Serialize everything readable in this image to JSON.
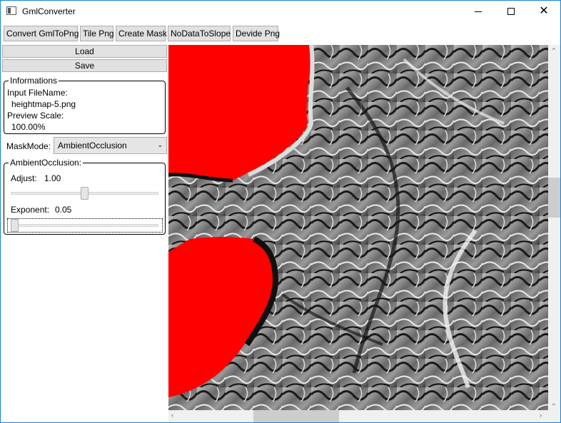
{
  "window": {
    "title": "GmlConverter",
    "controls": {
      "minimize": "minimize-icon",
      "maximize": "maximize-icon",
      "close": "close-icon"
    }
  },
  "toolbar": {
    "buttons": [
      "Convert GmlToPng",
      "Tile Png",
      "Create Mask",
      "NoDataToSlope",
      "Devide Png"
    ]
  },
  "panel": {
    "load_label": "Load",
    "save_label": "Save",
    "informations": {
      "title": "Informations",
      "input_filename_label": "Input FileName:",
      "input_filename_value": "heightmap-5.png",
      "preview_scale_label": "Preview Scale:",
      "preview_scale_value": "100.00%"
    },
    "mask_mode": {
      "label": "MaskMode:",
      "selected": "AmbientOcclusion"
    },
    "ambient_occlusion": {
      "title": "AmbientOcclusion:",
      "adjust_label": "Adjust:",
      "adjust_value": "1.00",
      "adjust_level": 0.5,
      "exponent_label": "Exponent:",
      "exponent_value": "0.05",
      "exponent_level": 0.0
    }
  },
  "preview": {
    "image_description_icon": "heightmap-preview",
    "mask_color": "#ff0000",
    "vertical_scroll_position": 0.4,
    "horizontal_scroll_position": 0.27
  }
}
